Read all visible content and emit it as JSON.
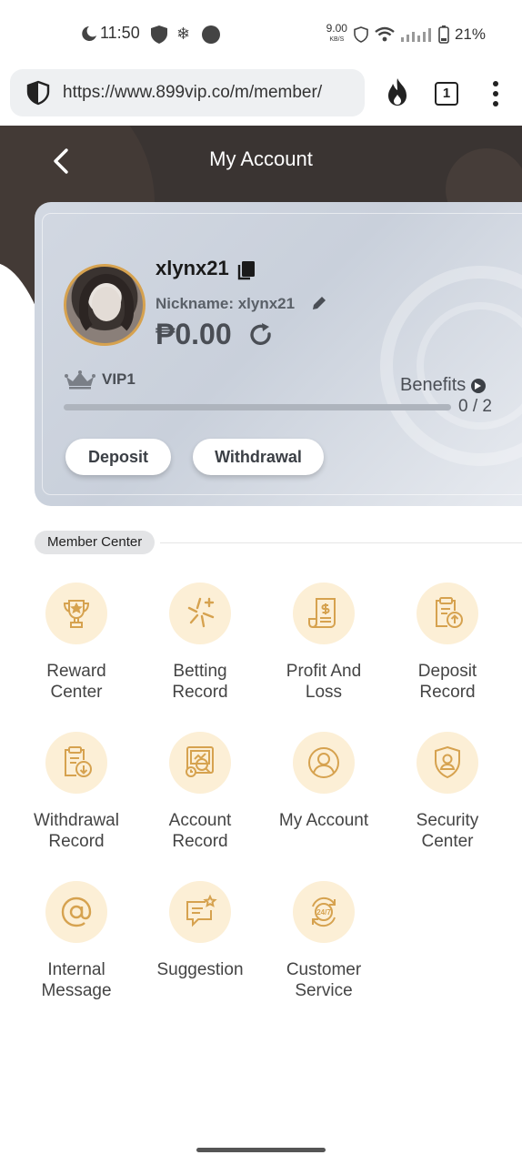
{
  "status_bar": {
    "time": "11:50",
    "net_speed": "9.00",
    "net_unit": "KB/S",
    "battery": "21%"
  },
  "browser": {
    "url": "https://www.899vip.co/m/member/",
    "tab_count": "1"
  },
  "header": {
    "title": "My Account"
  },
  "account": {
    "username": "xlynx21",
    "nickname": "Nickname: xlynx21",
    "balance": "₱0.00",
    "vip_level": "VIP1",
    "benefits_label": "Benefits",
    "progress_text": "0 / 2",
    "progress_fraction": 0,
    "deposit_label": "Deposit",
    "withdrawal_label": "Withdrawal"
  },
  "member_center": {
    "section_label": "Member Center",
    "items": [
      {
        "line1": "Reward",
        "line2": "Center",
        "icon": "trophy-icon"
      },
      {
        "line1": "Betting",
        "line2": "Record",
        "icon": "sparkle-icon"
      },
      {
        "line1": "Profit And",
        "line2": "Loss",
        "icon": "receipt-icon"
      },
      {
        "line1": "Deposit",
        "line2": "Record",
        "icon": "clipboard-up-icon"
      },
      {
        "line1": "Withdrawal",
        "line2": "Record",
        "icon": "clipboard-down-icon"
      },
      {
        "line1": "Account",
        "line2": "Record",
        "icon": "account-record-icon"
      },
      {
        "line1": "My Account",
        "line2": "",
        "icon": "user-icon"
      },
      {
        "line1": "Security",
        "line2": "Center",
        "icon": "shield-user-icon"
      },
      {
        "line1": "Internal",
        "line2": "Message",
        "icon": "at-icon"
      },
      {
        "line1": "Suggestion",
        "line2": "",
        "icon": "chat-star-icon"
      },
      {
        "line1": "Customer",
        "line2": "Service",
        "icon": "support-247-icon"
      }
    ]
  },
  "colors": {
    "header_bg": "#3a3432",
    "icon_circle": "#fcefd6",
    "icon_stroke": "#d6a24f"
  }
}
